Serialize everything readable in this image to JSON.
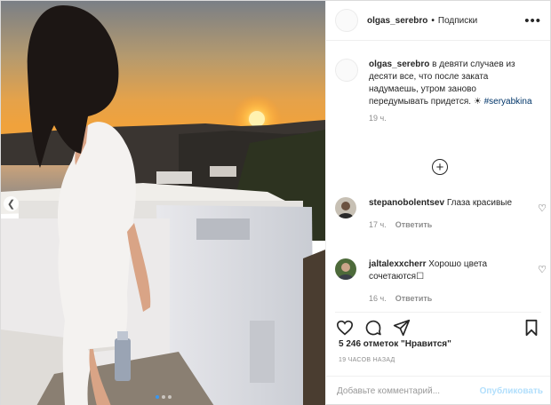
{
  "header": {
    "username": "olgas_serebro",
    "separator": "•",
    "follow_label": "Подписки",
    "more_icon": "more-horizontal-icon"
  },
  "caption": {
    "username": "olgas_serebro",
    "text": "в девяти случаев из десяти все, что после заката надумаешь, утром заново передумывать придется. ☀",
    "hashtag": "#seryabkina",
    "time": "19 ч."
  },
  "comments": [
    {
      "username": "stepanobolentsev",
      "text": "Глаза красивые",
      "time": "17 ч.",
      "reply_label": "Ответить"
    },
    {
      "username": "jaltalexxcherr",
      "text": "Хорошо цвета сочетаются☐",
      "time": "16 ч.",
      "reply_label": "Ответить"
    }
  ],
  "likes": "5 246 отметок \"Нравится\"",
  "post_time": "19 ЧАСОВ НАЗАД",
  "add_comment": {
    "placeholder": "Добавьте комментарий...",
    "publish_label": "Опубликовать"
  },
  "carousel": {
    "total": 3,
    "active_index": 0
  },
  "colors": {
    "accent": "#3897f0",
    "publish_disabled": "#b2dffc",
    "hashtag": "#003569",
    "muted": "#8e8e8e"
  }
}
